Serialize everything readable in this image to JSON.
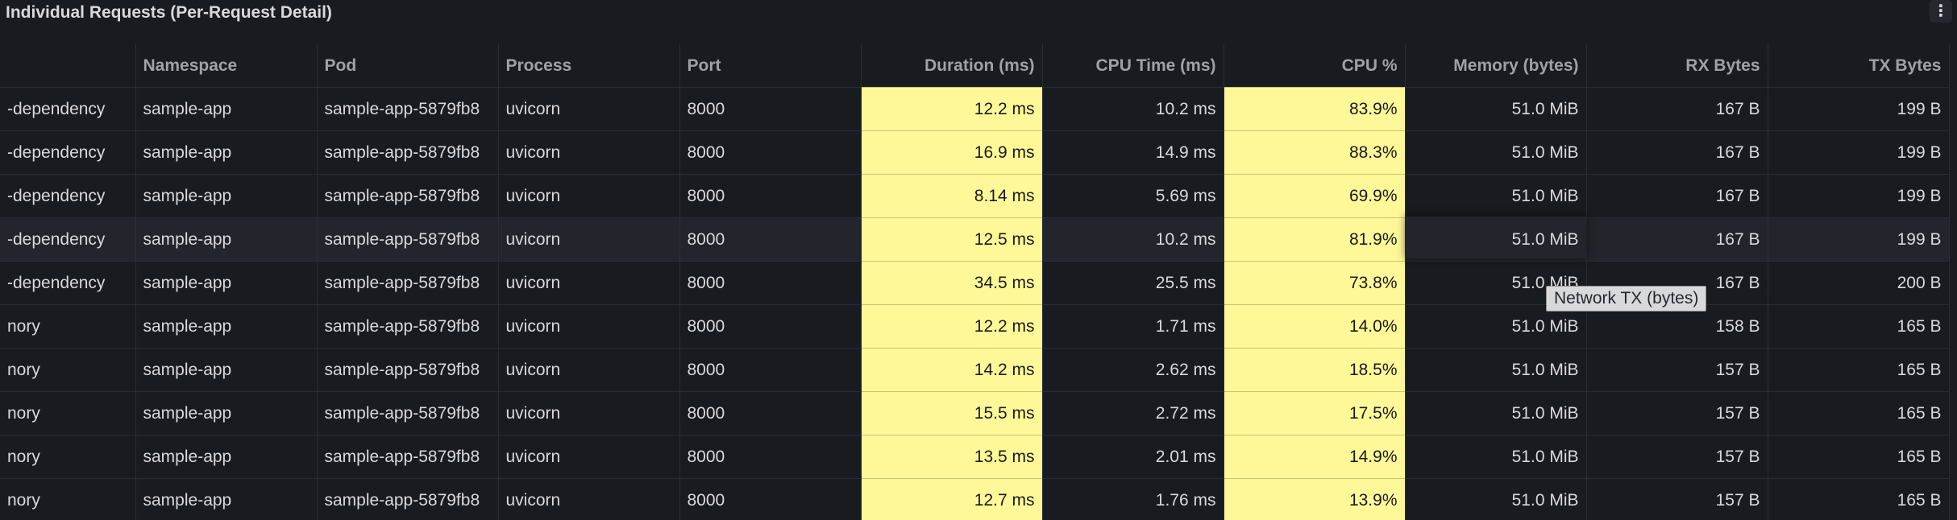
{
  "panel": {
    "title": "Individual Requests (Per-Request Detail)",
    "menu_icon": "⋮",
    "tooltip": "Network TX (bytes)"
  },
  "columns": [
    "",
    "Namespace",
    "Pod",
    "Process",
    "Port",
    "Duration (ms)",
    "CPU Time (ms)",
    "CPU %",
    "Memory (bytes)",
    "RX Bytes",
    "TX Bytes"
  ],
  "colors": {
    "background": "#181b1f",
    "highlight": "#fff899",
    "text": "#d8d9dd",
    "header_text": "#9fa1a8"
  },
  "rows": [
    [
      "-dependency",
      "sample-app",
      "sample-app-5879fb8",
      "uvicorn",
      "8000",
      "12.2 ms",
      "10.2 ms",
      "83.9%",
      "51.0 MiB",
      "167 B",
      "199 B"
    ],
    [
      "-dependency",
      "sample-app",
      "sample-app-5879fb8",
      "uvicorn",
      "8000",
      "16.9 ms",
      "14.9 ms",
      "88.3%",
      "51.0 MiB",
      "167 B",
      "199 B"
    ],
    [
      "-dependency",
      "sample-app",
      "sample-app-5879fb8",
      "uvicorn",
      "8000",
      "8.14 ms",
      "5.69 ms",
      "69.9%",
      "51.0 MiB",
      "167 B",
      "199 B"
    ],
    [
      "-dependency",
      "sample-app",
      "sample-app-5879fb8",
      "uvicorn",
      "8000",
      "12.5 ms",
      "10.2 ms",
      "81.9%",
      "51.0 MiB",
      "167 B",
      "199 B"
    ],
    [
      "-dependency",
      "sample-app",
      "sample-app-5879fb8",
      "uvicorn",
      "8000",
      "34.5 ms",
      "25.5 ms",
      "73.8%",
      "51.0 MiB",
      "167 B",
      "200 B"
    ],
    [
      "nory",
      "sample-app",
      "sample-app-5879fb8",
      "uvicorn",
      "8000",
      "12.2 ms",
      "1.71 ms",
      "14.0%",
      "51.0 MiB",
      "158 B",
      "165 B"
    ],
    [
      "nory",
      "sample-app",
      "sample-app-5879fb8",
      "uvicorn",
      "8000",
      "14.2 ms",
      "2.62 ms",
      "18.5%",
      "51.0 MiB",
      "157 B",
      "165 B"
    ],
    [
      "nory",
      "sample-app",
      "sample-app-5879fb8",
      "uvicorn",
      "8000",
      "15.5 ms",
      "2.72 ms",
      "17.5%",
      "51.0 MiB",
      "157 B",
      "165 B"
    ],
    [
      "nory",
      "sample-app",
      "sample-app-5879fb8",
      "uvicorn",
      "8000",
      "13.5 ms",
      "2.01 ms",
      "14.9%",
      "51.0 MiB",
      "157 B",
      "165 B"
    ],
    [
      "nory",
      "sample-app",
      "sample-app-5879fb8",
      "uvicorn",
      "8000",
      "12.7 ms",
      "1.76 ms",
      "13.9%",
      "51.0 MiB",
      "157 B",
      "165 B"
    ]
  ]
}
